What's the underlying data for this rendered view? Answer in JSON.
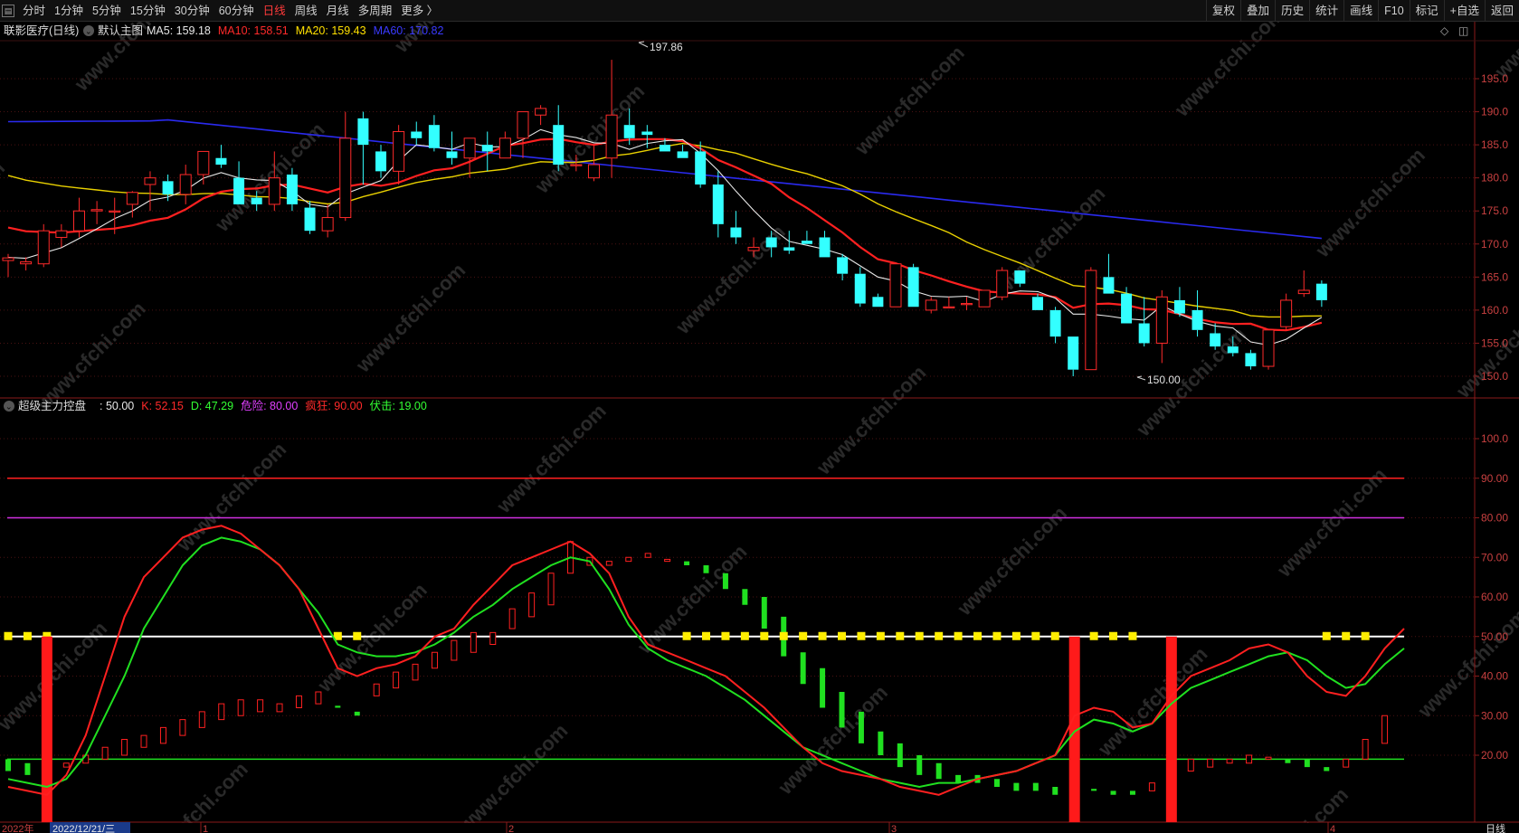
{
  "toolbar": {
    "periods": [
      "分时",
      "1分钟",
      "5分钟",
      "15分钟",
      "30分钟",
      "60分钟",
      "日线",
      "周线",
      "月线",
      "多周期",
      "更多 〉"
    ],
    "active_period": "日线",
    "right_buttons": [
      "复权",
      "叠加",
      "历史",
      "统计",
      "画线",
      "F10",
      "标记",
      "+自选",
      "返回"
    ]
  },
  "main_legend": {
    "title": "联影医疗(日线)",
    "template": "默认主图",
    "items": [
      {
        "label": "MA5: 159.18",
        "color": "#e8e8e8"
      },
      {
        "label": "MA10: 158.51",
        "color": "#ff2a2a"
      },
      {
        "label": "MA20: 159.43",
        "color": "#ffe000"
      },
      {
        "label": "MA60: 170.82",
        "color": "#3a3aff"
      }
    ]
  },
  "main_chart": {
    "price_axis": [
      "195.0",
      "190.0",
      "185.0",
      "180.0",
      "175.0",
      "170.0",
      "165.0",
      "160.0",
      "155.0",
      "150.0"
    ],
    "high_marker": "197.86",
    "low_marker": "150.00",
    "up_color": "#ff2a2a",
    "down_color": "#33ffff"
  },
  "indicator": {
    "title": "超级主力控盘",
    "items": [
      {
        "label": ": 50.00",
        "color": "#e8e8e8"
      },
      {
        "label": "K: 52.15",
        "color": "#ff2a2a"
      },
      {
        "label": "D: 47.29",
        "color": "#33ff33"
      },
      {
        "label": "危险: 80.00",
        "color": "#e040ff"
      },
      {
        "label": "疯狂: 90.00",
        "color": "#ff2a2a"
      },
      {
        "label": "伏击: 19.00",
        "color": "#33ff33"
      }
    ],
    "axis": [
      "100.0",
      "90.00",
      "80.00",
      "70.00",
      "60.00",
      "50.00",
      "40.00",
      "30.00",
      "20.00"
    ]
  },
  "bottom_axis": {
    "start": "2022年",
    "highlight": "2022/12/21/三",
    "months": [
      "1",
      "2",
      "3",
      "4"
    ],
    "period_label": "日线"
  },
  "watermark": "www.cfchi.com"
}
